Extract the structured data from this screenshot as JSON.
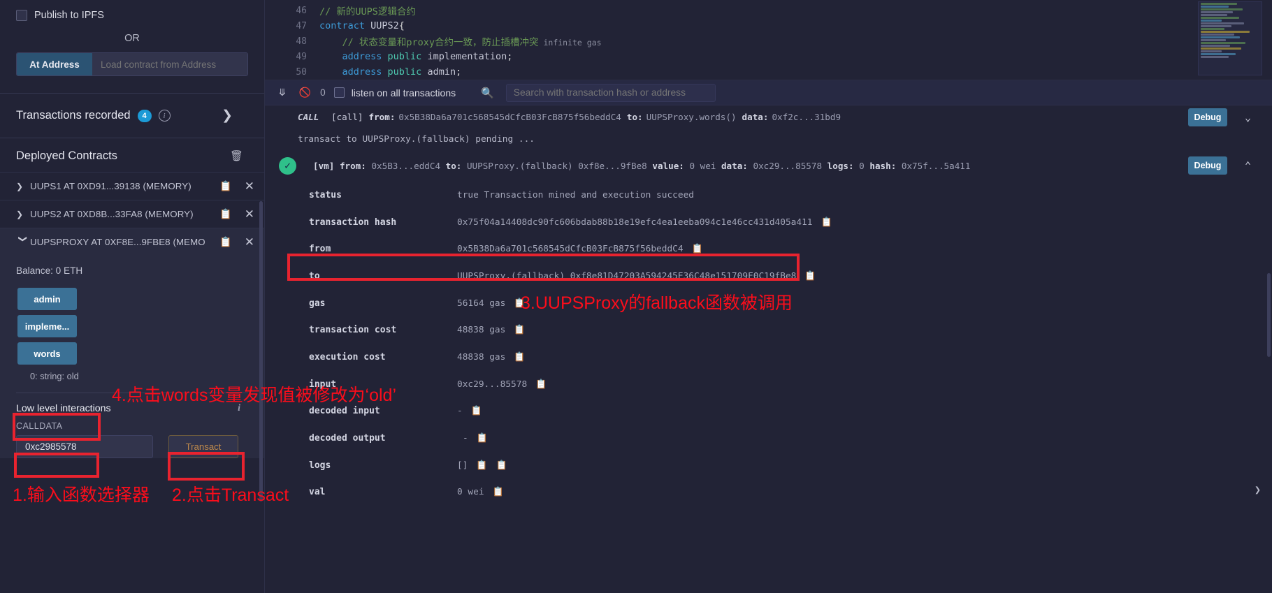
{
  "left_panel": {
    "publish_ipfs_label": "Publish to IPFS",
    "or_label": "OR",
    "at_address_button": "At Address",
    "at_address_placeholder": "Load contract from Address",
    "transactions_recorded_label": "Transactions recorded",
    "transactions_recorded_count": "4",
    "deployed_contracts_label": "Deployed Contracts",
    "contracts": [
      {
        "name": "UUPS1 AT 0XD91...39138 (MEMORY)",
        "expanded": false
      },
      {
        "name": "UUPS2 AT 0XD8B...33FA8 (MEMORY)",
        "expanded": false
      },
      {
        "name": "UUPSPROXY AT 0XF8E...9FBE8 (MEMO",
        "expanded": true
      }
    ],
    "balance": "Balance: 0 ETH",
    "functions": [
      {
        "label": "admin"
      },
      {
        "label": "impleme..."
      },
      {
        "label": "words"
      }
    ],
    "return_value": "0: string: old",
    "low_level_interactions_label": "Low level interactions",
    "calldata_label": "CALLDATA",
    "calldata_value": "0xc2985578",
    "transact_button": "Transact"
  },
  "editor": {
    "lines": [
      {
        "num": "46",
        "tokens": [
          {
            "t": "// 新的UUPS逻辑合约",
            "c": "c-com"
          }
        ]
      },
      {
        "num": "47",
        "tokens": [
          {
            "t": "contract ",
            "c": "c-kw"
          },
          {
            "t": "UUPS2",
            "c": "c-id"
          },
          {
            "t": "{",
            "c": "c-pun"
          }
        ]
      },
      {
        "num": "48",
        "tokens": [
          {
            "t": "    // 状态变量和proxy合约一致，防止插槽冲突",
            "c": "c-com"
          },
          {
            "t": " infinite gas",
            "c": "c-gas"
          }
        ]
      },
      {
        "num": "49",
        "tokens": [
          {
            "t": "    address ",
            "c": "c-kw"
          },
          {
            "t": "public ",
            "c": "c-type"
          },
          {
            "t": "implementation",
            "c": "c-id"
          },
          {
            "t": ";",
            "c": "c-pun"
          }
        ]
      },
      {
        "num": "50",
        "tokens": [
          {
            "t": "    address ",
            "c": "c-kw"
          },
          {
            "t": "public ",
            "c": "c-type"
          },
          {
            "t": "admin",
            "c": "c-id"
          },
          {
            "t": ";",
            "c": "c-pun"
          }
        ]
      }
    ]
  },
  "terminal_bar": {
    "count": "0",
    "listen_label": "listen on all transactions",
    "search_placeholder": "Search with transaction hash or address"
  },
  "terminal": {
    "call_line": {
      "tag": "CALL",
      "prefix": "[call]",
      "from_key": "from:",
      "from_val": "0x5B38Da6a701c568545dCfcB03FcB875f56beddC4",
      "to_key": "to:",
      "to_val": "UUPSProxy.words()",
      "data_key": "data:",
      "data_val": "0xf2c...31bd9",
      "debug_label": "Debug"
    },
    "pending_line": "transact to UUPSProxy.(fallback) pending ...",
    "vm_line": {
      "prefix": "[vm]",
      "from_key": "from:",
      "from_val": "0x5B3...eddC4",
      "to_key": "to:",
      "to_val": "UUPSProxy.(fallback) 0xf8e...9fBe8",
      "value_key": "value:",
      "value_val": "0 wei",
      "data_key": "data:",
      "data_val": "0xc29...85578",
      "logs_key": "logs:",
      "logs_val": "0",
      "hash_key": "hash:",
      "hash_val": "0x75f...5a411",
      "debug_label": "Debug"
    },
    "details": [
      {
        "key": "status",
        "value": "true Transaction mined and execution succeed",
        "copy": false
      },
      {
        "key": "transaction hash",
        "value": "0x75f04a14408dc90fc606bdab88b18e19efc4ea1eeba094c1e46cc431d405a411",
        "copy": true
      },
      {
        "key": "from",
        "value": "0x5B38Da6a701c568545dCfcB03FcB875f56beddC4",
        "copy": true
      },
      {
        "key": "to",
        "value": "UUPSProxy.(fallback) 0xf8e81D47203A594245E36C48e151709F0C19fBe8",
        "copy": true
      },
      {
        "key": "gas",
        "value": "56164 gas",
        "copy": true
      },
      {
        "key": "transaction cost",
        "value": "48838 gas",
        "copy": true
      },
      {
        "key": "execution cost",
        "value": "48838 gas",
        "copy": true
      },
      {
        "key": "input",
        "value": "0xc29...85578",
        "copy": true
      },
      {
        "key": "decoded input",
        "value": "-",
        "copy": true
      },
      {
        "key": "decoded output",
        "value": "-",
        "copy": true
      },
      {
        "key": "logs",
        "value": "[]",
        "copy": true,
        "copy2": true
      },
      {
        "key": "val",
        "value": "0 wei",
        "copy": true
      }
    ]
  },
  "annotations": [
    {
      "id": "ann1",
      "text": "1.输入函数选择器"
    },
    {
      "id": "ann2",
      "text": "2.点击Transact"
    },
    {
      "id": "ann3",
      "text": "3.UUPSProxy的fallback函数被调用"
    },
    {
      "id": "ann4",
      "text": "4.点击words变量发现值被修改为‘old’"
    }
  ],
  "colors": {
    "accent_blue": "#3b7196",
    "annotation_red": "#fc0d1b",
    "success_green": "#2fc08a",
    "badge_blue": "#1c9ad6"
  }
}
